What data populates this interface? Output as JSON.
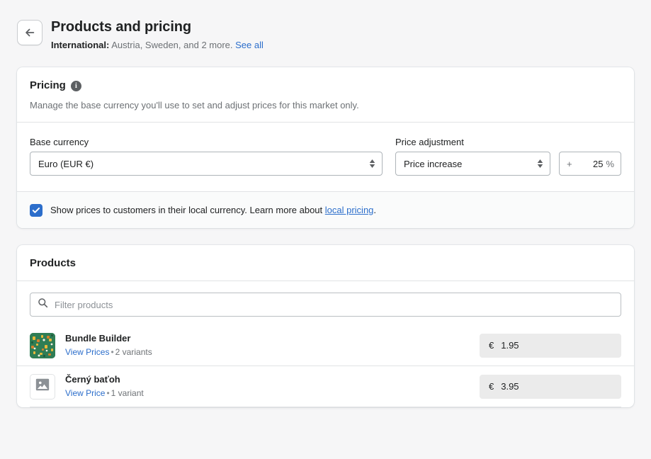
{
  "header": {
    "back_icon": "arrow-left-icon",
    "title": "Products and pricing",
    "subtitle_label": "International:",
    "subtitle_text": "Austria, Sweden, and 2 more.",
    "see_all_link": "See all"
  },
  "pricing_card": {
    "title": "Pricing",
    "info_icon": "info-icon",
    "info_glyph": "i",
    "description": "Manage the base currency you'll use to set and adjust prices for this market only.",
    "base_currency": {
      "label": "Base currency",
      "value": "Euro (EUR €)"
    },
    "price_adjustment": {
      "label": "Price adjustment",
      "value": "Price increase",
      "prefix": "+",
      "amount": "25",
      "suffix": "%"
    },
    "local_pricing": {
      "checked": true,
      "text_before": "Show prices to customers in their local currency. Learn more about ",
      "link": "local pricing",
      "text_after": "."
    }
  },
  "products_card": {
    "title": "Products",
    "search_placeholder": "Filter products",
    "search_value": "",
    "search_icon": "search-icon",
    "rows": [
      {
        "thumb_type": "image",
        "name": "Bundle Builder",
        "link": "View Prices",
        "separator": "•",
        "variants": "2 variants",
        "currency": "€",
        "price": "1.95"
      },
      {
        "thumb_type": "placeholder",
        "name": "Černý baťoh",
        "link": "View Price",
        "separator": "•",
        "variants": "1 variant",
        "currency": "€",
        "price": "3.95"
      }
    ]
  },
  "colors": {
    "accent": "#2c6ecb",
    "page_bg": "#f6f6f7",
    "card_bg": "#ffffff",
    "border": "#e1e3e5",
    "text": "#202223",
    "subdued": "#6d7175",
    "thumb_green": "#2f7d55",
    "price_field_bg": "#ebebeb"
  }
}
